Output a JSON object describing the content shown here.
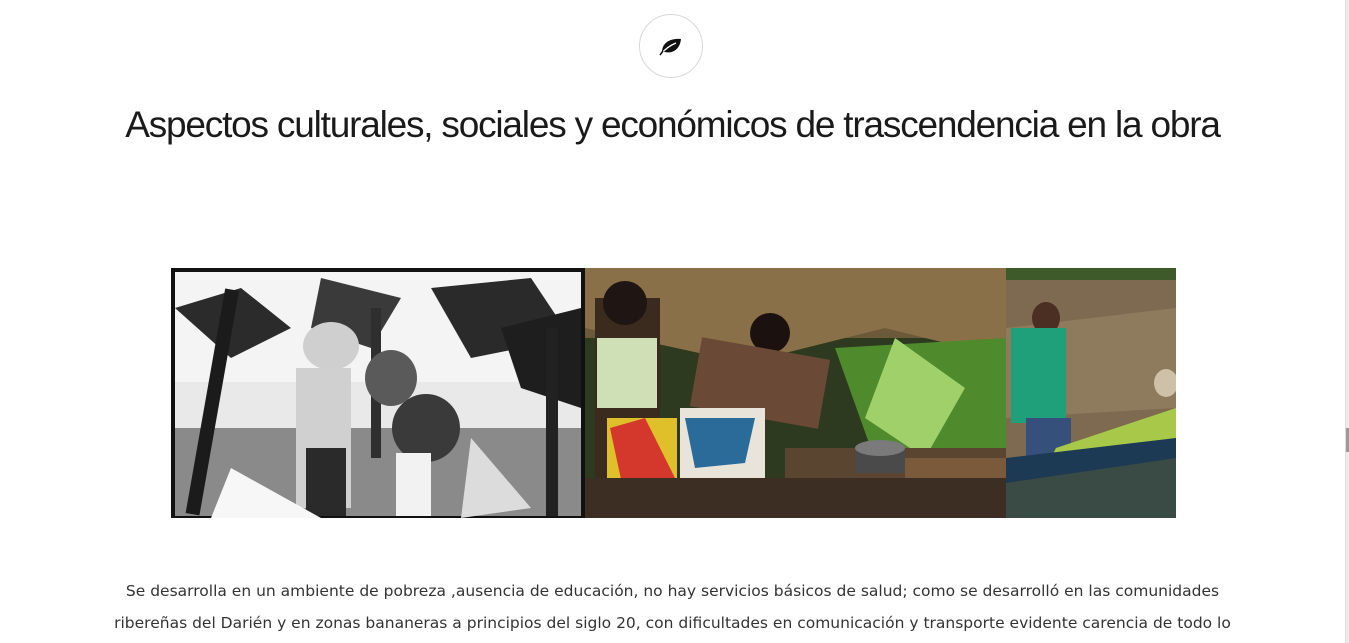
{
  "header": {
    "icon": "leaf-icon",
    "title": "Aspectos culturales, sociales y económicos de trascendencia en la obra"
  },
  "gallery": {
    "photos": [
      {
        "id": "photo-banana-plantation",
        "icon": "bw-photo",
        "style": "black-and-white"
      },
      {
        "id": "photo-village-cooking",
        "icon": "color-photo",
        "style": "color"
      },
      {
        "id": "photo-river-canoe",
        "icon": "color-photo",
        "style": "color"
      }
    ]
  },
  "content": {
    "paragraph": "Se desarrolla en un ambiente de pobreza ,ausencia de educación, no hay servicios básicos de salud; como se desarrolló en las comunidades ribereñas del Darién y en zonas bananeras a principios del siglo 20, con dificultades en comunicación y transporte evidente carencia de todo lo que"
  },
  "colors": {
    "background": "#ffffff",
    "title": "#1a1a1a",
    "text": "#333333",
    "circle_border": "#d8d8d8"
  }
}
